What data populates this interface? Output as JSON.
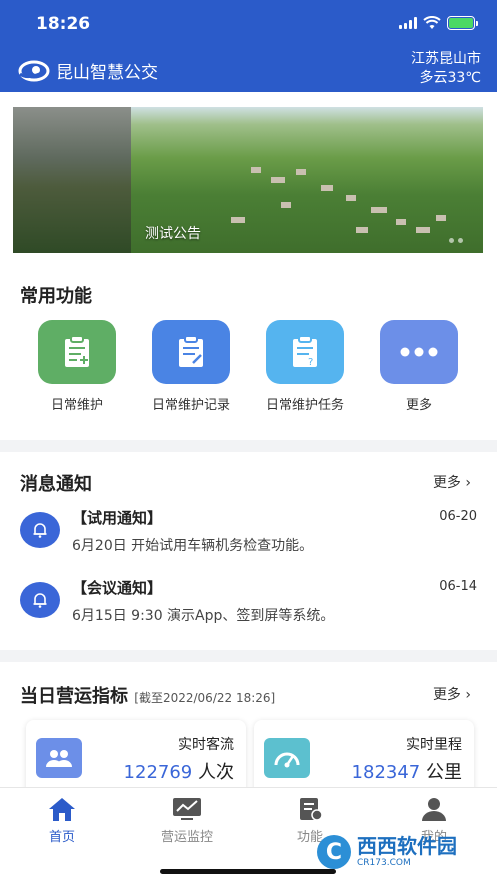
{
  "status_bar": {
    "time": "18:26"
  },
  "header": {
    "app_title": "昆山智慧公交",
    "city": "江苏昆山市",
    "weather": "多云33℃"
  },
  "banner": {
    "caption": "测试公告"
  },
  "functions": {
    "title": "常用功能",
    "items": [
      {
        "label": "日常维护",
        "icon": "clipboard-add-icon",
        "color": "#5fae65"
      },
      {
        "label": "日常维护记录",
        "icon": "clipboard-edit-icon",
        "color": "#4a84e4"
      },
      {
        "label": "日常维护任务",
        "icon": "clipboard-question-icon",
        "color": "#55b4ef"
      },
      {
        "label": "更多",
        "icon": "more-dots-icon",
        "color": "#6c8fe8"
      }
    ]
  },
  "messages": {
    "title": "消息通知",
    "more": "更多",
    "items": [
      {
        "title": "【试用通知】",
        "date": "06-20",
        "body": "6月20日 开始试用车辆机务检查功能。"
      },
      {
        "title": "【会议通知】",
        "date": "06-14",
        "body": "6月15日 9:30 演示App、签到屏等系统。"
      }
    ]
  },
  "stats": {
    "title": "当日营运指标",
    "subtitle": "[截至2022/06/22 18:26]",
    "more": "更多",
    "items": [
      {
        "label": "实时客流",
        "value": "122769",
        "unit": "人次",
        "icon": "passengers-icon"
      },
      {
        "label": "实时里程",
        "value": "182347",
        "unit": "公里",
        "icon": "speedometer-icon"
      }
    ]
  },
  "tabbar": {
    "tabs": [
      {
        "label": "首页",
        "icon": "home-icon",
        "active": true
      },
      {
        "label": "营运监控",
        "icon": "monitor-chart-icon",
        "active": false
      },
      {
        "label": "功能",
        "icon": "function-doc-icon",
        "active": false
      },
      {
        "label": "我的",
        "icon": "user-icon",
        "active": false
      }
    ]
  },
  "watermark": {
    "main": "西西软件园",
    "sub": "CR173.COM"
  },
  "colors": {
    "primary": "#2b5bc9",
    "accent_blue": "#3a66d8"
  }
}
